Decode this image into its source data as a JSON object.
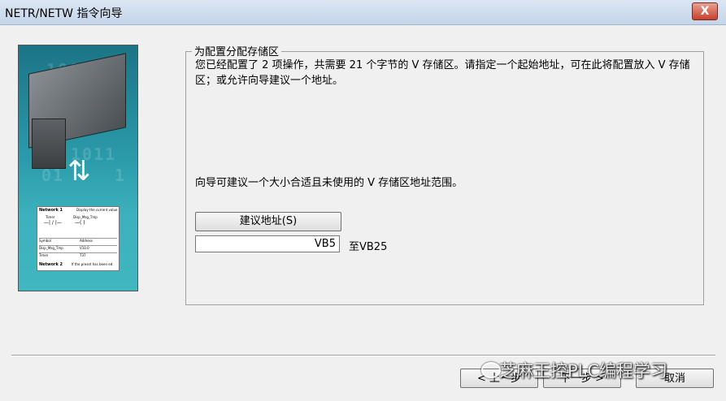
{
  "window": {
    "title": "NETR/NETW 指令向导",
    "close_glyph": "X"
  },
  "side_image": {
    "bg_digits": [
      "1001",
      "10101",
      "1",
      "1011",
      "01",
      "1"
    ],
    "ladder": {
      "network1": "Network 1",
      "network1_comment": "Display the current value",
      "timer": "Timer",
      "disp_tag": "Disp_Msg_Tmp",
      "contact": "—| / |—",
      "coil": "—( )",
      "symbol_header": "Symbol",
      "address_header": "Address",
      "row1_symbol": "Disp_Msg_Tmp",
      "row1_address": "V10.0",
      "row2_symbol": "Timer",
      "row2_address": "T37",
      "network2": "Network 2",
      "network2_comment": "If the preset has been ed"
    }
  },
  "group": {
    "label": "为配置分配存储区",
    "description": "您已经配置了 2 项操作，共需要 21 个字节的 V 存储区。请指定一个起始地址，可在此将配置放入 V 存储区；或允许向导建议一个地址。",
    "suggest_note": "向导可建议一个大小合适且未使用的 V 存储区地址范围。",
    "suggest_button": "建议地址(S)",
    "start_address": "VB5",
    "range_text": "至VB25"
  },
  "buttons": {
    "prev": "< 上一步",
    "next": "下一步 >",
    "cancel": "取消"
  },
  "watermark": {
    "text": "芝麻王控PLC编程学习"
  }
}
